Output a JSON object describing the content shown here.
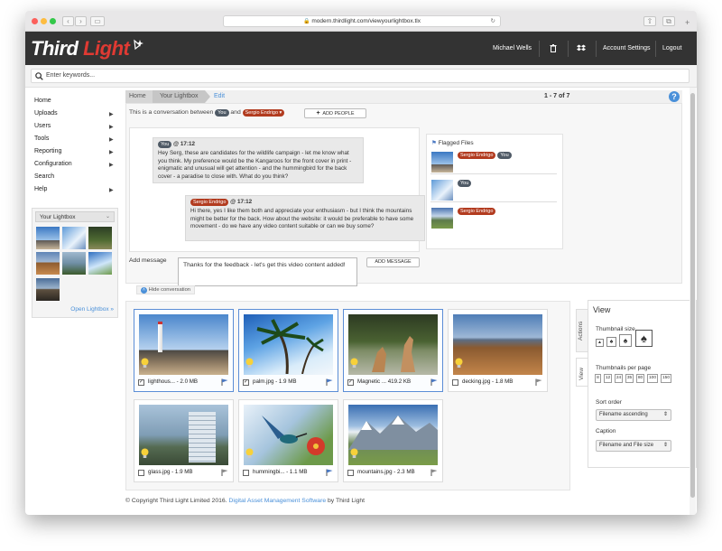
{
  "browser": {
    "url": "modern.thirdlight.com/viewyourlightbox.tlx"
  },
  "header": {
    "logo_part1": "Third ",
    "logo_part2": "Light",
    "user_name": "Michael Wells",
    "account_settings": "Account Settings",
    "logout": "Logout"
  },
  "search": {
    "placeholder": "Enter keywords..."
  },
  "sidebar": {
    "items": [
      {
        "label": "Home",
        "arrow": ""
      },
      {
        "label": "Uploads",
        "arrow": "▶"
      },
      {
        "label": "Users",
        "arrow": "▶"
      },
      {
        "label": "Tools",
        "arrow": "▶"
      },
      {
        "label": "Reporting",
        "arrow": "▶"
      },
      {
        "label": "Configuration",
        "arrow": "▶"
      },
      {
        "label": "Search",
        "arrow": ""
      },
      {
        "label": "Help",
        "arrow": "▶"
      }
    ],
    "lightbox_title": "Your Lightbox",
    "open_lightbox": "Open Lightbox »"
  },
  "breadcrumb": {
    "home": "Home",
    "current": "Your Lightbox",
    "edit": "Edit",
    "count": "1 - 7 of 7"
  },
  "conversation": {
    "intro": "This is a conversation between",
    "and": "and",
    "you": "You",
    "other": "Sergio Endrigo",
    "add_people": "ADD PEOPLE",
    "messages": [
      {
        "author": "You",
        "time": "@ 17:12",
        "text": "Hey Serg, these are candidates for the wildlife campaign - let me know what you think. My preference would be the Kangaroos for the front cover in print - enigmatic and unusual will get attention - and the hummingbird for the back cover - a paradise to close with. What do you think?"
      },
      {
        "author": "Sergio Endrigo",
        "time": "@ 17:12",
        "text": "Hi there, yes I like them both and appreciate your enthusiasm - but I think the mountains might be better for the back. How about the website: it would be preferable to have some movement - do we have any video content suitable or can we buy some?"
      }
    ],
    "flagged_title": "Flagged Files",
    "add_message_label": "Add message",
    "add_message_value": "Thanks for the feedback - let's get this video content added!",
    "add_message_button": "ADD MESSAGE",
    "hide": "Hide conversation"
  },
  "files": [
    {
      "caption": "lighthous... - 2.0 MB",
      "checked": "✓"
    },
    {
      "caption": "palm.jpg - 1.9 MB",
      "checked": "✓"
    },
    {
      "caption": "Magnetic ... 419.2 KB",
      "checked": "✓"
    },
    {
      "caption": "decking.jpg - 1.8 MB",
      "checked": ""
    },
    {
      "caption": "glass.jpg - 1.9 MB",
      "checked": ""
    },
    {
      "caption": "hummingbi... - 1.1 MB",
      "checked": ""
    },
    {
      "caption": "mountains.jpg - 2.3 MB",
      "checked": ""
    }
  ],
  "view_panel": {
    "title": "View",
    "tab_actions": "Actions",
    "tab_view": "View",
    "thumb_size": "Thumbnail size",
    "per_page": "Thumbnails per page",
    "per_page_options": [
      "8",
      "12",
      "24",
      "35",
      "80",
      "100",
      "150"
    ],
    "sort_order": "Sort order",
    "sort_value": "Filename ascending",
    "caption": "Caption",
    "caption_value": "Filename and File size"
  },
  "footer": {
    "text": "© Copyright Third Light Limited 2016.",
    "link": "Digital Asset Management Software",
    "suffix": "by Third Light"
  },
  "colors": {
    "brand_red": "#e03a33",
    "top_bar": "#333333",
    "link_blue": "#4a90d9",
    "selected_border": "#5b8dd6"
  }
}
